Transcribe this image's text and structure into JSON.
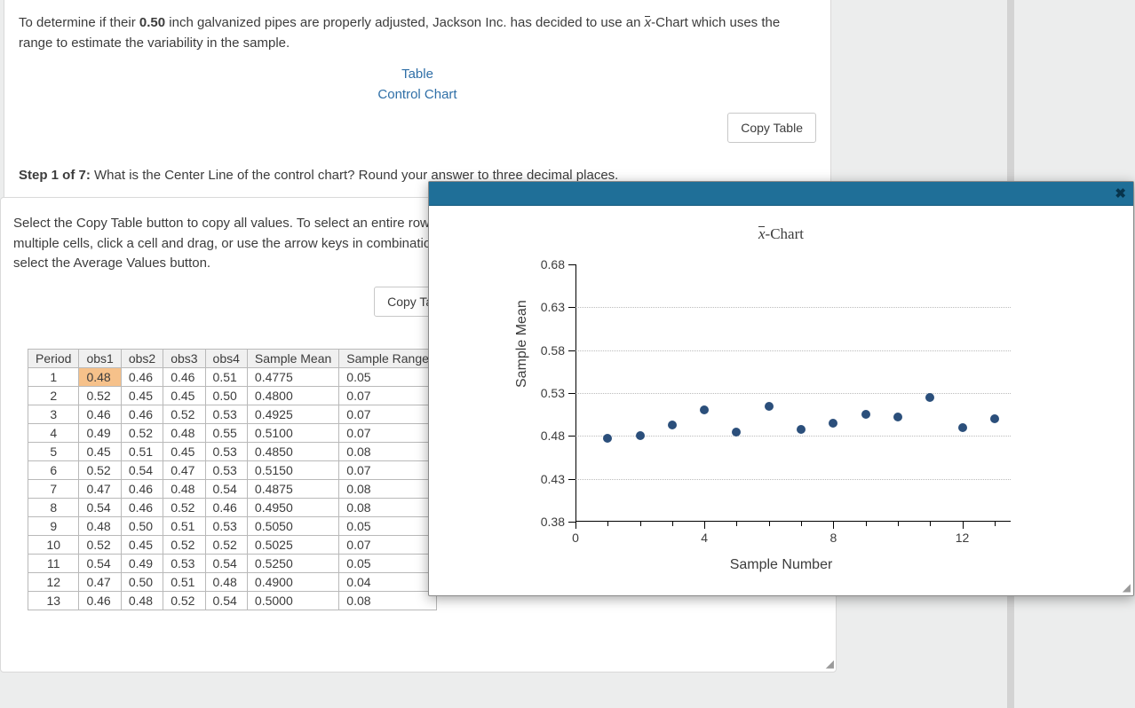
{
  "problem": {
    "pretext": "To determine if their ",
    "pipe_size": "0.50",
    "midtext1": " inch galvanized pipes are properly adjusted, Jackson Inc. has decided to use an ",
    "xbar": "x",
    "midtext2": "-Chart which uses the range to estimate the variability in the sample."
  },
  "links": {
    "table": "Table",
    "control_chart": "Control Chart"
  },
  "buttons": {
    "copy_table_1": "Copy Table",
    "copy_table_2": "Copy Table"
  },
  "step": {
    "label": "Step 1 of 7:",
    "text": " What is the Center Line of the control chart? Round your answer to three decimal places."
  },
  "data_panel": {
    "instructions": "Select the Copy Table button to copy all values. To select an entire row or column of cells, select the appropriate header cell. To select multiple cells, click a cell and drag, or use the arrow keys in combination with the Shift key. To find the average of the selected cells, select the Average Values button."
  },
  "table": {
    "headers": [
      "Period",
      "obs1",
      "obs2",
      "obs3",
      "obs4",
      "Sample Mean",
      "Sample Range"
    ],
    "rows": [
      {
        "period": "1",
        "obs": [
          "0.48",
          "0.46",
          "0.46",
          "0.51"
        ],
        "mean": "0.4775",
        "range": "0.05",
        "sel": 0
      },
      {
        "period": "2",
        "obs": [
          "0.52",
          "0.45",
          "0.45",
          "0.50"
        ],
        "mean": "0.4800",
        "range": "0.07"
      },
      {
        "period": "3",
        "obs": [
          "0.46",
          "0.46",
          "0.52",
          "0.53"
        ],
        "mean": "0.4925",
        "range": "0.07"
      },
      {
        "period": "4",
        "obs": [
          "0.49",
          "0.52",
          "0.48",
          "0.55"
        ],
        "mean": "0.5100",
        "range": "0.07"
      },
      {
        "period": "5",
        "obs": [
          "0.45",
          "0.51",
          "0.45",
          "0.53"
        ],
        "mean": "0.4850",
        "range": "0.08"
      },
      {
        "period": "6",
        "obs": [
          "0.52",
          "0.54",
          "0.47",
          "0.53"
        ],
        "mean": "0.5150",
        "range": "0.07"
      },
      {
        "period": "7",
        "obs": [
          "0.47",
          "0.46",
          "0.48",
          "0.54"
        ],
        "mean": "0.4875",
        "range": "0.08"
      },
      {
        "period": "8",
        "obs": [
          "0.54",
          "0.46",
          "0.52",
          "0.46"
        ],
        "mean": "0.4950",
        "range": "0.08"
      },
      {
        "period": "9",
        "obs": [
          "0.48",
          "0.50",
          "0.51",
          "0.53"
        ],
        "mean": "0.5050",
        "range": "0.05"
      },
      {
        "period": "10",
        "obs": [
          "0.52",
          "0.45",
          "0.52",
          "0.52"
        ],
        "mean": "0.5025",
        "range": "0.07"
      },
      {
        "period": "11",
        "obs": [
          "0.54",
          "0.49",
          "0.53",
          "0.54"
        ],
        "mean": "0.5250",
        "range": "0.05"
      },
      {
        "period": "12",
        "obs": [
          "0.47",
          "0.50",
          "0.51",
          "0.48"
        ],
        "mean": "0.4900",
        "range": "0.04"
      },
      {
        "period": "13",
        "obs": [
          "0.46",
          "0.48",
          "0.52",
          "0.54"
        ],
        "mean": "0.5000",
        "range": "0.08"
      }
    ]
  },
  "chart_data": {
    "type": "scatter",
    "title_prefix": "x",
    "title_suffix": "-Chart",
    "xlabel": "Sample Number",
    "ylabel": "Sample Mean",
    "xlim": [
      0,
      13.5
    ],
    "ylim": [
      0.38,
      0.68
    ],
    "yticks": [
      0.38,
      0.43,
      0.48,
      0.53,
      0.58,
      0.63,
      0.68
    ],
    "xticks_major": [
      0,
      4,
      8,
      12
    ],
    "xticks_minor": [
      1,
      2,
      3,
      5,
      6,
      7,
      9,
      10,
      11,
      13
    ],
    "x": [
      1,
      2,
      3,
      4,
      5,
      6,
      7,
      8,
      9,
      10,
      11,
      12,
      13
    ],
    "y": [
      0.4775,
      0.48,
      0.4925,
      0.51,
      0.485,
      0.515,
      0.4875,
      0.495,
      0.505,
      0.5025,
      0.525,
      0.49,
      0.5
    ]
  },
  "popup": {
    "close_glyph": "✖"
  }
}
